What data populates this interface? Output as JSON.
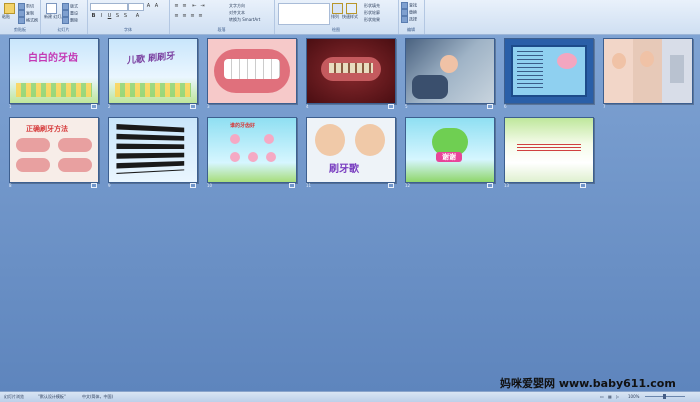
{
  "ribbon": {
    "clipboard": {
      "label": "剪贴板",
      "paste": "粘贴",
      "cut": "剪切",
      "copy": "复制",
      "format_painter": "格式刷"
    },
    "slides": {
      "label": "幻灯片",
      "new_slide": "新建\n幻灯片",
      "layout": "版式",
      "reset": "重设",
      "delete": "删除"
    },
    "font": {
      "label": "字体"
    },
    "paragraph": {
      "label": "段落",
      "text_direction": "文字方向",
      "align_text": "对齐文本",
      "smartart": "转换为 SmartArt"
    },
    "drawing": {
      "label": "绘图",
      "arrange": "排列",
      "quick_styles": "快速样式",
      "shape_fill": "形状填充",
      "shape_outline": "形状轮廓",
      "shape_effects": "形状效果"
    },
    "editing": {
      "label": "编辑",
      "find": "查找",
      "replace": "替换",
      "select": "选择"
    }
  },
  "slides": [
    {
      "num": "1",
      "title": "白白的牙齿",
      "theme": "sky"
    },
    {
      "num": "2",
      "title": "儿歌 刷刷牙",
      "theme": "sky"
    },
    {
      "num": "3",
      "title": "",
      "theme": "mouth"
    },
    {
      "num": "4",
      "title": "",
      "theme": "teeth-photo"
    },
    {
      "num": "5",
      "title": "",
      "theme": "dentist-photo"
    },
    {
      "num": "6",
      "title": "",
      "theme": "poster"
    },
    {
      "num": "7",
      "title": "",
      "theme": "kids-photo"
    },
    {
      "num": "8",
      "title": "正确刷牙方法",
      "theme": "method"
    },
    {
      "num": "9",
      "title": "",
      "theme": "verse"
    },
    {
      "num": "10",
      "title": "谁的牙齿好",
      "theme": "cartoon"
    },
    {
      "num": "11",
      "title": "刷牙歌",
      "theme": "kids-cartoon"
    },
    {
      "num": "12",
      "title": "谢谢",
      "theme": "frog"
    },
    {
      "num": "13",
      "title": "",
      "theme": "credits"
    }
  ],
  "status": {
    "view": "幻灯片浏览",
    "theme": "\"默认设计模板\"",
    "language": "中文(简体，中国)",
    "zoom": "100%"
  },
  "watermark": "妈咪爱婴网 www.baby611.com"
}
